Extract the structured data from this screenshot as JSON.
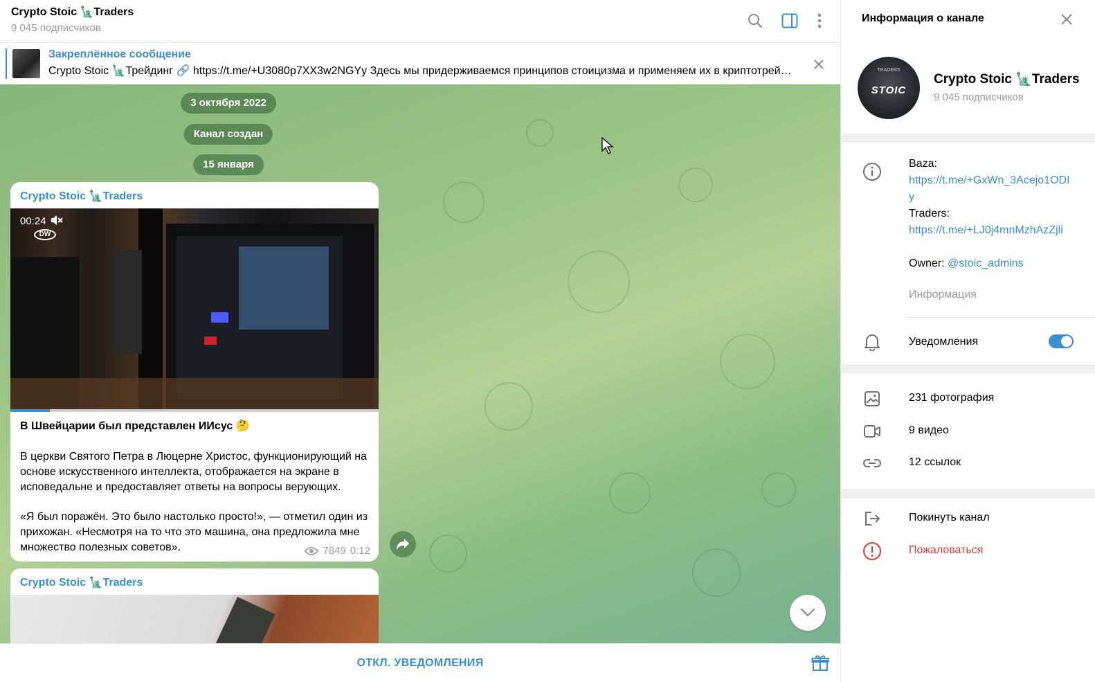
{
  "chat": {
    "title": "Crypto Stoic 🗽Traders",
    "subscribers": "9 045 подписчиков"
  },
  "pinned": {
    "label": "Закреплённое сообщение",
    "text": "Crypto Stoic 🗽Трейдинг 🔗 https://t.me/+U3080p7XX3w2NGYy  Здесь мы придерживаемся принципов стоицизма и применяем их в криптотрейдинге…"
  },
  "dates": [
    "3 октября 2022",
    "Канал создан",
    "15 января"
  ],
  "messages": [
    {
      "author": "Crypto Stoic 🗽Traders",
      "video_duration": "00:24",
      "video_watermark": "DW",
      "video_progress": 0.107,
      "headline": "В Швейцарии был представлен ИИсус 🤔",
      "paragraph1": "В церкви Святого Петра в Люцерне Христос, функционирующий на основе искусственного интеллекта, отображается на экране в исповедальне и предоставляет ответы на вопросы верующих.",
      "paragraph2": "«Я был поражён. Это было настолько просто!», — отметил один из прихожан. «Несмотря на то что это машина, она предложила мне множество полезных советов».",
      "views": "7849",
      "time": "0:12"
    },
    {
      "author": "Crypto Stoic 🗽Traders"
    }
  ],
  "footer": {
    "mute_label": "ОТКЛ. УВЕДОМЛЕНИЯ"
  },
  "info": {
    "title": "Информация о канале",
    "name": "Crypto Stoic 🗽Traders",
    "subscribers": "9 045 подписчиков",
    "avatar_top": "TRADERS",
    "avatar_word": "STOIC",
    "about_baza_label": "Baza:",
    "about_baza_link": "https://t.me/+GxWn_3Acejo1ODIy",
    "about_traders_label": "Traders:",
    "about_traders_link": "https://t.me/+LJ0j4mnMzhAzZjli",
    "about_owner_label": "Owner:",
    "about_owner_handle": "@stoic_admins",
    "about_caption": "Информация",
    "notifications_label": "Уведомления",
    "notifications_on": true,
    "photos": "231 фотография",
    "videos": "9 видео",
    "links": "12 ссылок",
    "leave": "Покинуть канал",
    "report": "Пожаловаться"
  },
  "colors": {
    "accent": "#3a8fd0",
    "danger": "#e53935",
    "chat_bg": "#9cc487"
  },
  "icons": {
    "header": [
      "search-icon",
      "sidebar-toggle-icon",
      "more-vertical-icon"
    ],
    "info": [
      "info-icon",
      "bell-icon",
      "photo-icon",
      "video-icon",
      "link-icon",
      "leave-icon",
      "report-icon"
    ]
  }
}
